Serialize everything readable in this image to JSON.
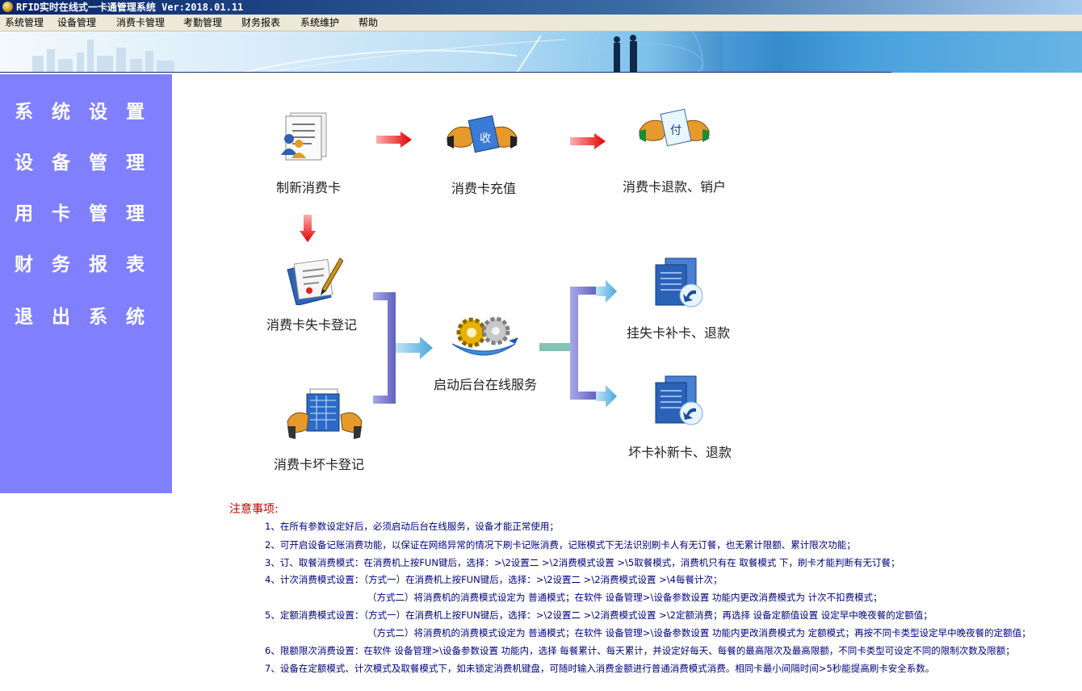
{
  "window": {
    "title": "RFID实时在线式一卡通管理系统 Ver:2018.01.11"
  },
  "menu": {
    "items": [
      "系统管理",
      "设备管理",
      "消费卡管理",
      "考勤管理",
      "财务报表",
      "系统维护",
      "帮助"
    ]
  },
  "sidebar": {
    "items": [
      "系统设置",
      "设备管理",
      "用卡管理",
      "财务报表",
      "退出系统"
    ]
  },
  "flow": {
    "new_card": "制新消费卡",
    "recharge": "消费卡充值",
    "refund_close": "消费卡退款、销户",
    "lost_register": "消费卡失卡登记",
    "broken_register": "消费卡坏卡登记",
    "start_service": "启动后台在线服务",
    "lost_reissue": "挂失卡补卡、退款",
    "broken_reissue": "坏卡补新卡、退款",
    "recharge_icon_text": "收",
    "refund_icon_text": "付"
  },
  "notes": {
    "title": "注意事项:",
    "lines": [
      "1、在所有参数设定好后，必须启动后台在线服务，设备才能正常使用；",
      "2、可开启设备记账消费功能，以保证在网络异常的情况下刷卡记账消费，记账模式下无法识别刷卡人有无订餐，也无累计限额、累计限次功能；",
      "3、订、取餐消费模式：在消费机上按FUN键后，选择：>\\2设置二 >\\2消费模式设置 >\\5取餐模式，消费机只有在 取餐模式 下，刷卡才能判断有无订餐；",
      "4、计次消费模式设置：（方式一）在消费机上按FUN键后，选择：>\\2设置二 >\\2消费模式设置 >\\4每餐计次；",
      "（方式二）将消费机的消费模式设定为 普通模式；在软件 设备管理>\\设备参数设置 功能内更改消费模式为 计次不扣费模式；",
      "5、定额消费模式设置：（方式一）在消费机上按FUN键后，选择：>\\2设置二 >\\2消费模式设置 >\\2定额消费；再选择 设备定额值设置 设定早中晚夜餐的定额值；",
      "（方式二）将消费机的消费模式设定为 普通模式；在软件 设备管理>\\设备参数设置 功能内更改消费模式为 定额模式；再按不同卡类型设定早中晚夜餐的定额值；",
      "6、限额限次消费设置：在软件 设备管理>\\设备参数设置 功能内，选择 每餐累计、每天累计，并设定好每天、每餐的最高限次及最高限额，不同卡类型可设定不同的限制次数及限额；",
      "7、设备在定额模式、计次模式及取餐模式下，如未锁定消费机键盘，可随时输入消费金额进行普通消费模式消费。相同卡最小间隔时间>5秒能提高刷卡安全系数。"
    ]
  }
}
